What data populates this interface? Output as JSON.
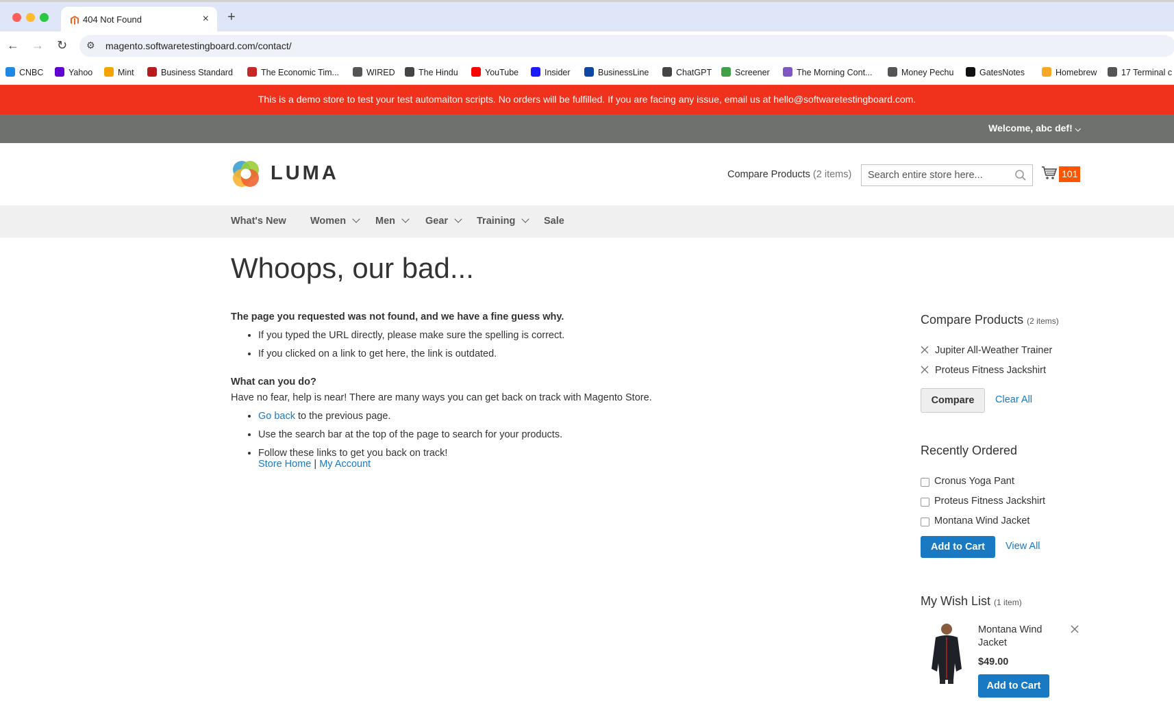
{
  "browser": {
    "tab_title": "404 Not Found",
    "tab_close": "×",
    "new_tab": "+",
    "url": "magento.softwaretestingboard.com/contact/",
    "bookmarks": [
      {
        "label": "CNBC",
        "color": "#1e88e5"
      },
      {
        "label": "Yahoo",
        "color": "#6001d2"
      },
      {
        "label": "Mint",
        "color": "#f4a300"
      },
      {
        "label": "Business Standard",
        "color": "#b71c1c"
      },
      {
        "label": "The Economic Tim...",
        "color": "#c62828"
      },
      {
        "label": "WIRED",
        "color": "#555555"
      },
      {
        "label": "The Hindu",
        "color": "#444444"
      },
      {
        "label": "YouTube",
        "color": "#ff0000"
      },
      {
        "label": "Insider",
        "color": "#1a1aff"
      },
      {
        "label": "BusinessLine",
        "color": "#0d47a1"
      },
      {
        "label": "ChatGPT",
        "color": "#444444"
      },
      {
        "label": "Screener",
        "color": "#43a047"
      },
      {
        "label": "The Morning Cont...",
        "color": "#7e57c2"
      },
      {
        "label": "Money Pechu",
        "color": "#555555"
      },
      {
        "label": "GatesNotes",
        "color": "#111111"
      },
      {
        "label": "Homebrew",
        "color": "#f9a825"
      },
      {
        "label": "17 Terminal c",
        "color": "#555555"
      }
    ]
  },
  "demo_banner": "This is a demo store to test your test automaiton scripts. No orders will be fulfilled. If you are facing any issue, email us at hello@softwaretestingboard.com.",
  "header": {
    "welcome": "Welcome, abc def!",
    "logo_text": "LUMA",
    "compare_label": "Compare Products",
    "compare_count": "(2 items)",
    "search_placeholder": "Search entire store here...",
    "cart_count": "101"
  },
  "nav": [
    {
      "label": "What's New",
      "has_menu": false
    },
    {
      "label": "Women",
      "has_menu": true
    },
    {
      "label": "Men",
      "has_menu": true
    },
    {
      "label": "Gear",
      "has_menu": true
    },
    {
      "label": "Training",
      "has_menu": true
    },
    {
      "label": "Sale",
      "has_menu": false
    }
  ],
  "main": {
    "title": "Whoops, our bad...",
    "not_found_heading": "The page you requested was not found, and we have a fine guess why.",
    "reasons": [
      "If you typed the URL directly, please make sure the spelling is correct.",
      "If you clicked on a link to get here, the link is outdated."
    ],
    "what_heading": "What can you do?",
    "what_text": "Have no fear, help is near! There are many ways you can get back on track with Magento Store.",
    "go_back_link": "Go back",
    "go_back_rest": " to the previous page.",
    "search_tip": "Use the search bar at the top of the page to search for your products.",
    "follow_links": "Follow these links to get you back on track!",
    "store_home": "Store Home",
    "separator": "|",
    "my_account": "My Account"
  },
  "sidebar": {
    "compare": {
      "title": "Compare Products",
      "count": "(2 items)",
      "items": [
        "Jupiter All-Weather Trainer",
        "Proteus Fitness Jackshirt"
      ],
      "compare_button": "Compare",
      "clear_all": "Clear All"
    },
    "recently_ordered": {
      "title": "Recently Ordered",
      "items": [
        "Cronus Yoga Pant",
        "Proteus Fitness Jackshirt",
        "Montana Wind Jacket"
      ],
      "add_to_cart": "Add to Cart",
      "view_all": "View All"
    },
    "wishlist": {
      "title": "My Wish List",
      "count": "(1 item)",
      "item_name": "Montana Wind Jacket",
      "item_price": "$49.00",
      "add_to_cart": "Add to Cart"
    }
  }
}
